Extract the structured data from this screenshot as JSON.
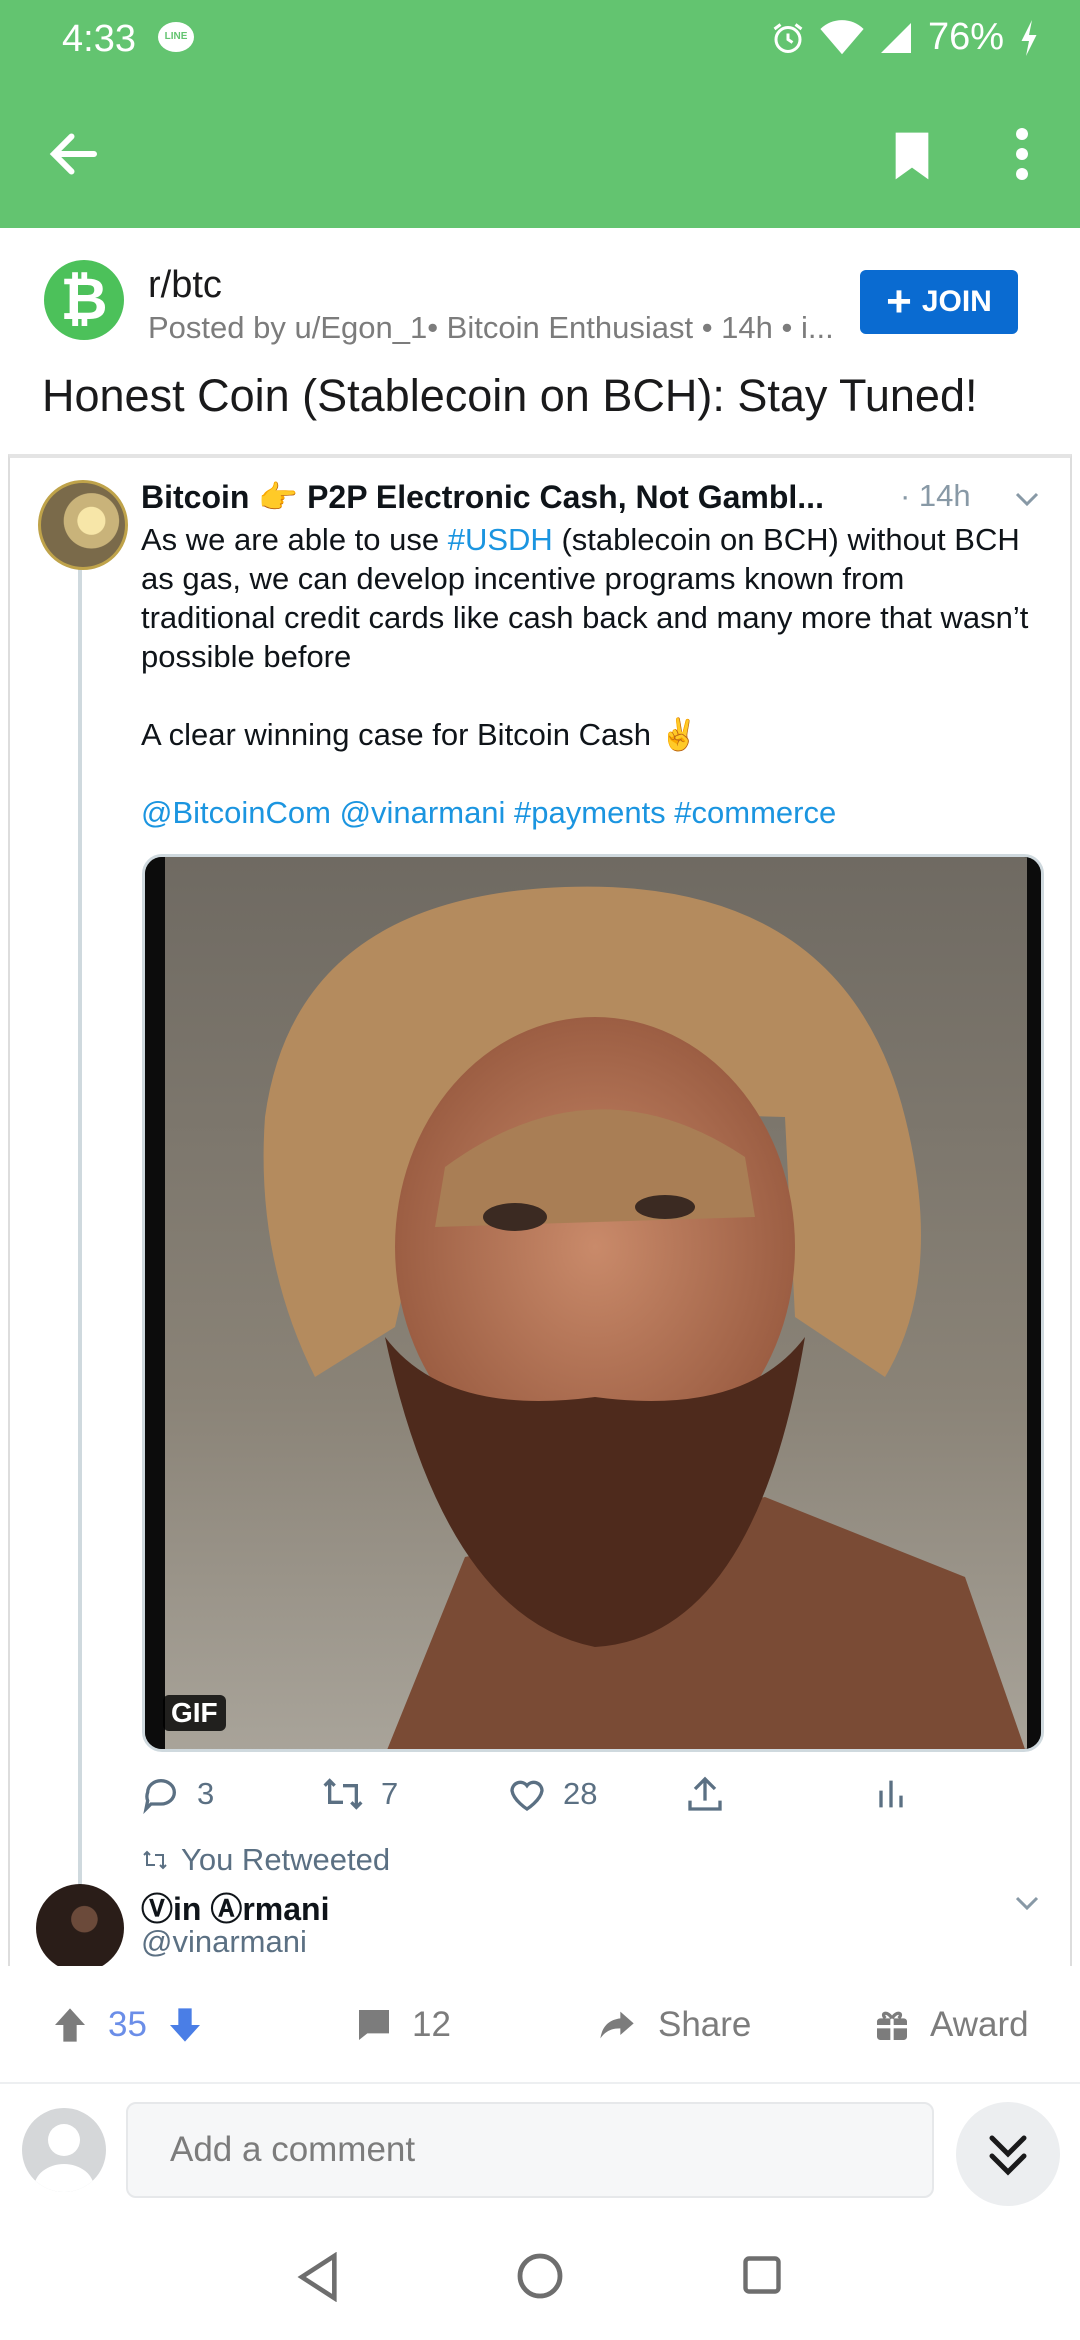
{
  "status_bar": {
    "time": "4:33",
    "app_icon": "LINE",
    "battery": "76%",
    "icons": [
      "line-icon",
      "alarm-icon",
      "wifi-icon",
      "signal-icon",
      "charging-icon"
    ]
  },
  "app_bar": {
    "color": "#63c470",
    "icons": [
      "back-arrow-icon",
      "bookmark-icon",
      "more-vertical-icon"
    ]
  },
  "post": {
    "subreddit": "r/btc",
    "posted_by": "Posted by u/Egon_1• Bitcoin Enthusiast • 14h • i...",
    "join_label": "JOIN",
    "title": "Honest Coin (Stablecoin on BCH): Stay Tuned!"
  },
  "tweet": {
    "name_part1": "Bitcoin",
    "name_part2": "P2P Electronic Cash, Not Gambl...",
    "time": "· 14h",
    "text_line1_a": "As we are able to use ",
    "text_line1_link": "#USDH",
    "text_line1_b": " (stablecoin on BCH) without BCH as gas, we can develop incentive programs known from traditional credit cards like cash back and many more that wasn’t possible before",
    "text_line2": "A clear winning case for Bitcoin Cash",
    "mentions": "@BitcoinCom  @vinarmani #payments #commerce",
    "gif_label": "GIF",
    "replies": "3",
    "retweets": "7",
    "likes": "28",
    "retweeted_label": "You Retweeted",
    "rt_name": "Ⓥin Ⓐrmani",
    "rt_handle": "@vinarmani"
  },
  "bottom_bar": {
    "score": "35",
    "comments": "12",
    "share_label": "Share",
    "award_label": "Award"
  },
  "comment": {
    "placeholder": "Add a comment"
  }
}
